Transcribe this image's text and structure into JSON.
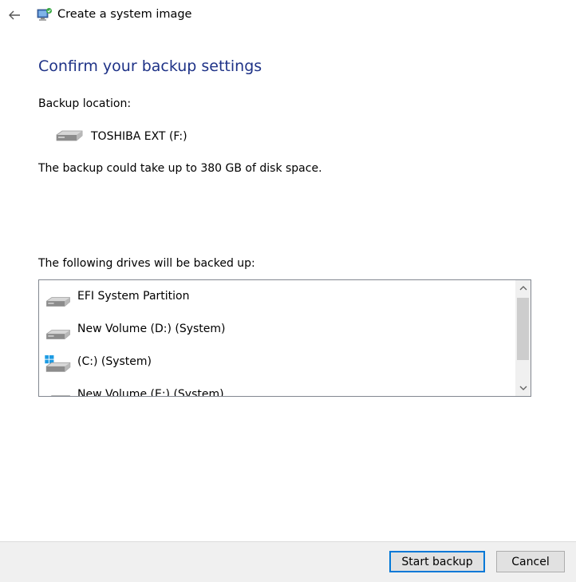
{
  "window": {
    "title": "Create a system image"
  },
  "page": {
    "heading": "Confirm your backup settings",
    "backup_location_label": "Backup location:",
    "backup_location": {
      "drive_name": "TOSHIBA EXT (F:)",
      "icon": "hard-drive-icon"
    },
    "space_note": "The backup could take up to 380 GB of disk space.",
    "drives_label": "The following drives will be backed up:",
    "drives": [
      {
        "label": "EFI System Partition",
        "icon": "hard-drive-icon"
      },
      {
        "label": "New Volume (D:) (System)",
        "icon": "hard-drive-icon"
      },
      {
        "label": "(C:) (System)",
        "icon": "windows-drive-icon"
      },
      {
        "label": "New Volume (E:) (System)",
        "icon": "hard-drive-icon"
      }
    ]
  },
  "footer": {
    "start_label": "Start backup",
    "cancel_label": "Cancel"
  },
  "colors": {
    "heading": "#1e3287",
    "primary_button_border": "#0078d7",
    "footer_bg": "#f0f0f0"
  }
}
